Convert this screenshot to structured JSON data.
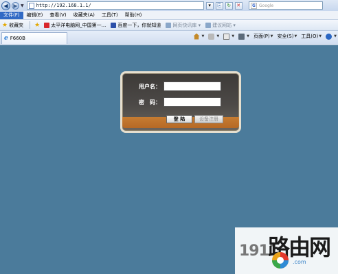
{
  "browser": {
    "address": "http://192.168.1.1/",
    "search_placeholder": "Google",
    "menu": [
      "文件(F)",
      "编辑(E)",
      "查看(V)",
      "收藏夹(A)",
      "工具(T)",
      "帮助(H)"
    ],
    "favorites_label": "收藏夹",
    "favorites": [
      {
        "label": "太平洋电脑网_中国第一...",
        "color": "#d8262b",
        "dim": false
      },
      {
        "label": "百度一下，你就知道",
        "color": "#2b4fa9",
        "dim": false
      },
      {
        "label": "网页快讯库 ▾",
        "color": "#8aa7c9",
        "dim": true
      },
      {
        "label": "建议网站 ▾",
        "color": "#8aa7c9",
        "dim": true
      }
    ],
    "tab_title": "F660B",
    "commands": [
      "页面(P)",
      "安全(S)",
      "工具(O)"
    ]
  },
  "login": {
    "username_label": "用户名：",
    "password_label": "密　码：",
    "login_button": "登 陆",
    "register_button": "设备注册"
  },
  "watermark": {
    "number": "1911",
    "text": "路由网",
    "domain": ".com"
  },
  "colors": {
    "page_bg": "#4b7b9b",
    "panel": "#45423f",
    "accent": "#d9822c"
  }
}
